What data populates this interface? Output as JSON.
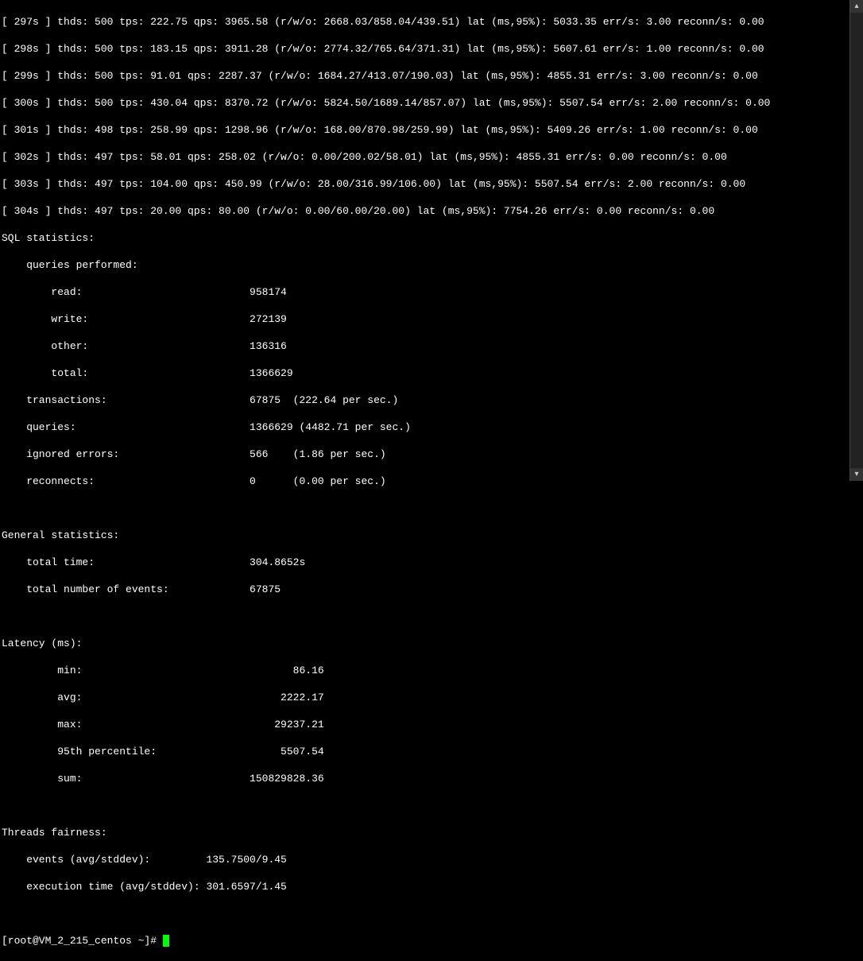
{
  "log_lines": [
    {
      "s": "297s",
      "thds": "500",
      "tps": "222.75",
      "qps": "3965.58",
      "rwo": "2668.03/858.04/439.51",
      "lat": "5033.35",
      "err": "3.00",
      "reconn": "0.00"
    },
    {
      "s": "298s",
      "thds": "500",
      "tps": "183.15",
      "qps": "3911.28",
      "rwo": "2774.32/765.64/371.31",
      "lat": "5607.61",
      "err": "1.00",
      "reconn": "0.00"
    },
    {
      "s": "299s",
      "thds": "500",
      "tps": "91.01",
      "qps": "2287.37",
      "rwo": "1684.27/413.07/190.03",
      "lat": "4855.31",
      "err": "3.00",
      "reconn": "0.00"
    },
    {
      "s": "300s",
      "thds": "500",
      "tps": "430.04",
      "qps": "8370.72",
      "rwo": "5824.50/1689.14/857.07",
      "lat": "5507.54",
      "err": "2.00",
      "reconn": "0.00"
    },
    {
      "s": "301s",
      "thds": "498",
      "tps": "258.99",
      "qps": "1298.96",
      "rwo": "168.00/870.98/259.99",
      "lat": "5409.26",
      "err": "1.00",
      "reconn": "0.00"
    },
    {
      "s": "302s",
      "thds": "497",
      "tps": "58.01",
      "qps": "258.02",
      "rwo": "0.00/200.02/58.01",
      "lat": "4855.31",
      "err": "0.00",
      "reconn": "0.00"
    },
    {
      "s": "303s",
      "thds": "497",
      "tps": "104.00",
      "qps": "450.99",
      "rwo": "28.00/316.99/106.00",
      "lat": "5507.54",
      "err": "2.00",
      "reconn": "0.00"
    },
    {
      "s": "304s",
      "thds": "497",
      "tps": "20.00",
      "qps": "80.00",
      "rwo": "0.00/60.00/20.00",
      "lat": "7754.26",
      "err": "0.00",
      "reconn": "0.00"
    }
  ],
  "sql": {
    "header": "SQL statistics:",
    "queries_performed": "    queries performed:",
    "read_lbl": "        read:",
    "read_val": "958174",
    "write_lbl": "        write:",
    "write_val": "272139",
    "other_lbl": "        other:",
    "other_val": "136316",
    "total_lbl": "        total:",
    "total_val": "1366629",
    "trans_lbl": "    transactions:",
    "trans_val": "67875  (222.64 per sec.)",
    "queries_lbl": "    queries:",
    "queries_val": "1366629 (4482.71 per sec.)",
    "ign_lbl": "    ignored errors:",
    "ign_val": "566    (1.86 per sec.)",
    "reconn_lbl": "    reconnects:",
    "reconn_val": "0      (0.00 per sec.)"
  },
  "general": {
    "header": "General statistics:",
    "time_lbl": "    total time:",
    "time_val": "304.8652s",
    "events_lbl": "    total number of events:",
    "events_val": "67875"
  },
  "latency": {
    "header": "Latency (ms):",
    "min_lbl": "         min:",
    "min_val": "86.16",
    "avg_lbl": "         avg:",
    "avg_val": "2222.17",
    "max_lbl": "         max:",
    "max_val": "29237.21",
    "p95_lbl": "         95th percentile:",
    "p95_val": "5507.54",
    "sum_lbl": "         sum:",
    "sum_val": "150829828.36"
  },
  "threads": {
    "header": "Threads fairness:",
    "ev_lbl": "    events (avg/stddev):",
    "ev_val": "135.7500/9.45",
    "ex_lbl": "    execution time (avg/stddev):",
    "ex_val": "301.6597/1.45"
  },
  "prompt": {
    "user": "[root@VM_2_215_centos ~]# "
  },
  "scroll": {
    "up": "▴",
    "down": "▾"
  }
}
